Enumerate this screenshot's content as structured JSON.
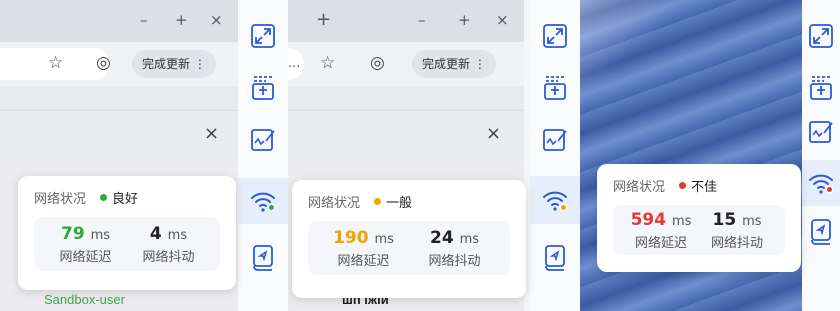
{
  "panels": [
    {
      "browser": {
        "tab_add": "",
        "update_button": "完成更新 ⋮",
        "bottom_text": "Sandbox-user"
      },
      "network": {
        "title": "网络状况",
        "status": "良好",
        "status_color": "#2faa3a",
        "latency_value": "79",
        "latency_unit": "ms",
        "latency_label": "网络延迟",
        "latency_color": "#2faa3a",
        "jitter_value": "4",
        "jitter_unit": "ms",
        "jitter_label": "网络抖动"
      }
    },
    {
      "browser": {
        "tab_add": "+",
        "update_button": "完成更新 ⋮",
        "omni_text": "...",
        "bottom_text": "шп іжій"
      },
      "network": {
        "title": "网络状况",
        "status": "一般",
        "status_color": "#f0a500",
        "latency_value": "190",
        "latency_unit": "ms",
        "latency_label": "网络延迟",
        "latency_color": "#f0a500",
        "jitter_value": "24",
        "jitter_unit": "ms",
        "jitter_label": "网络抖动"
      }
    },
    {
      "network": {
        "title": "网络状况",
        "status": "不佳",
        "status_color": "#e53935",
        "latency_value": "594",
        "latency_unit": "ms",
        "latency_label": "网络延迟",
        "latency_color": "#e53935",
        "jitter_value": "15",
        "jitter_unit": "ms",
        "jitter_label": "网络抖动"
      }
    }
  ],
  "toolbar_icons": [
    "expand-icon",
    "screenshot-list-icon",
    "signature-icon",
    "wifi-icon",
    "feedback-icon"
  ]
}
